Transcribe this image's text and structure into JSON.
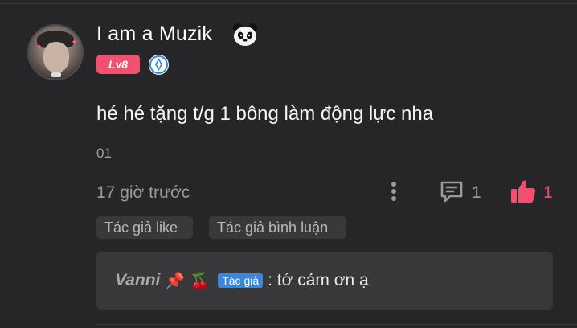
{
  "comment": {
    "username": "I am a Muzik",
    "level_badge": "Lv8",
    "text": "hé hé tặng t/g 1 bông làm động lực nha",
    "index": "01",
    "timestamp": "17 giờ trước",
    "reply_count": "1",
    "like_count": "1",
    "icons": {
      "panda": "panda-icon",
      "verified": "verify-badge-icon",
      "more": "more-vertical-icon",
      "reply": "comment-icon",
      "like": "thumbs-up-icon"
    },
    "colors": {
      "level_badge": "#f2506f",
      "like": "#f2506f",
      "author_tag": "#3a87d9"
    }
  },
  "chips": {
    "author_like": "Tác giả like",
    "author_reply": "Tác giả bình luận"
  },
  "reply": {
    "author": "Vanni",
    "author_tag": "Tác giả",
    "text": ": tớ cảm ơn ạ",
    "icons": [
      "pushpin-icon",
      "cherry-icon"
    ]
  }
}
